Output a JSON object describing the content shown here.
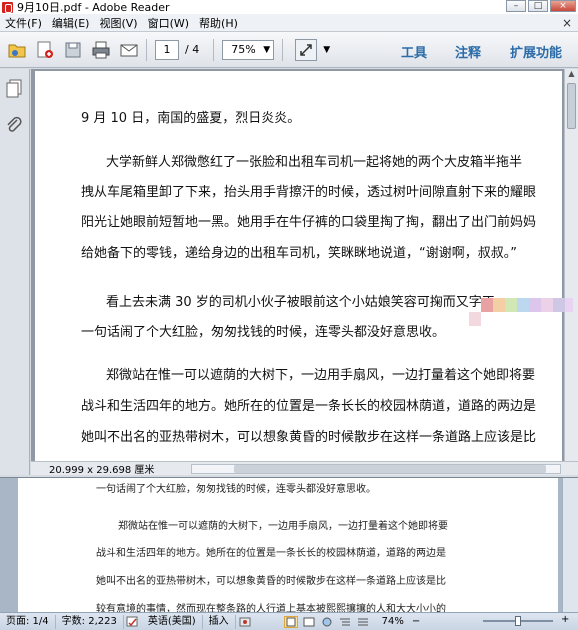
{
  "window": {
    "title": "9月10日.pdf - Adobe Reader",
    "buttons": [
      "–",
      "□",
      "×"
    ]
  },
  "menu": {
    "items": [
      "文件(F)",
      "编辑(E)",
      "视图(V)",
      "窗口(W)",
      "帮助(H)"
    ],
    "close": "×"
  },
  "toolbar": {
    "page_current": "1",
    "page_total": "/ 4",
    "zoom": "75%",
    "zoom_arrow": "▼",
    "expand_arrow": "▼",
    "links": [
      "工具",
      "注释",
      "扩展功能"
    ]
  },
  "document": {
    "lines": [
      "9 月 10 日，南国的盛夏，烈日炎炎。",
      "大学新鲜人郑微憋红了一张脸和出租车司机一起将她的两个大皮箱半拖半",
      "拽从车尾箱里卸了下来，抬头用手背擦汗的时候，透过树叶间隙直射下来的耀眼",
      "阳光让她眼前短暂地一黑。她用手在牛仔裤的口袋里掏了掏，翻出了出门前妈妈",
      "给她备下的零钱，递给身边的出租车司机，笑眯眯地说道，“谢谢啊，叔叔。”",
      "看上去未满 30 岁的司机小伙子被眼前这个小姑娘笑容可掬而又字正",
      "一句话闹了个大红脸，匆匆找钱的时候，连零头都没好意思收。",
      "郑微站在惟一可以遮荫的大树下，一边用手扇风，一边打量着这个她即将要",
      "战斗和生活四年的地方。她所在的位置是一条长长的校园林荫道，道路的两边是",
      "她叫不出名的亚热带树木，可以想象黄昏的时候散步在这样一条道路上应该是比"
    ]
  },
  "status": {
    "dimensions": "20.999 x 29.698 厘米"
  },
  "overlay_colors": [
    "#f2a5a5",
    "#f7d6a8",
    "#cfe8b4",
    "#b7d7f0",
    "#d8c2ec",
    "#ebd0e6",
    "#c9c4e2",
    "#e9d3f3",
    "#f3d9df"
  ],
  "word": {
    "lines": [
      "一句话闹了个大红脸，匆匆找钱的时候，连零头都没好意思收。",
      "郑微站在惟一可以遮荫的大树下，一边用手扇风，一边打量着这个她即将要",
      "战斗和生活四年的地方。她所在的位置是一条长长的校园林荫道，道路的两边是",
      "她叫不出名的亚热带树木，可以想象黄昏的时候散步在这样一条道路上应该是比",
      "较有意境的事情，然而现在整条路的人行道上基本被熙熙攘攘的人和大大小小的"
    ],
    "status": {
      "page": "页面: 1/4",
      "words": "字数: 2,223",
      "language": "英语(美国)",
      "insert": "插入",
      "zoom": "74%",
      "minus": "−",
      "plus": "+"
    }
  }
}
